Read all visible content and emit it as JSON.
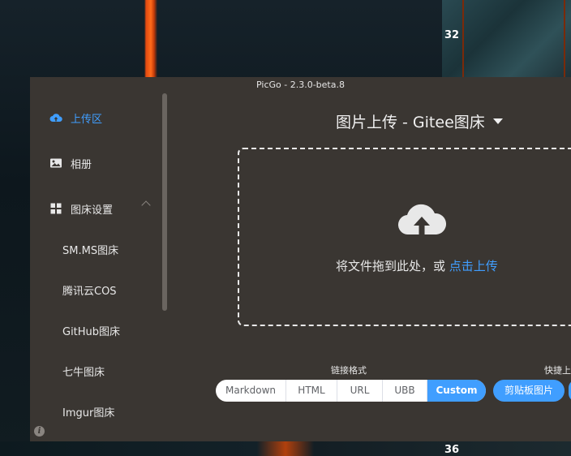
{
  "desktop": {
    "numbers": [
      "32",
      "36"
    ]
  },
  "window": {
    "title": "PicGo - 2.3.0-beta.8"
  },
  "sidebar": {
    "items": [
      {
        "label": "上传区",
        "icon": "upload-cloud-icon",
        "active": true
      },
      {
        "label": "相册",
        "icon": "image-icon",
        "active": false
      },
      {
        "label": "图床设置",
        "icon": "grid-icon",
        "active": false,
        "expanded": true
      }
    ],
    "sub_items": [
      "SM.MS图床",
      "腾讯云COS",
      "GitHub图床",
      "七牛图床",
      "Imgur图床"
    ]
  },
  "main": {
    "title": "图片上传 - Gitee图床",
    "dropzone": {
      "text": "将文件拖到此处，或 ",
      "link": "点击上传"
    },
    "link_format_label": "链接格式",
    "link_formats": [
      {
        "label": "Markdown",
        "active": false
      },
      {
        "label": "HTML",
        "active": false
      },
      {
        "label": "URL",
        "active": false
      },
      {
        "label": "UBB",
        "active": false
      },
      {
        "label": "Custom",
        "active": true
      }
    ],
    "quick_upload_label": "快捷上传",
    "clipboard_button": "剪贴板图片"
  },
  "colors": {
    "accent": "#409eff",
    "window_bg": "#3a3632"
  }
}
